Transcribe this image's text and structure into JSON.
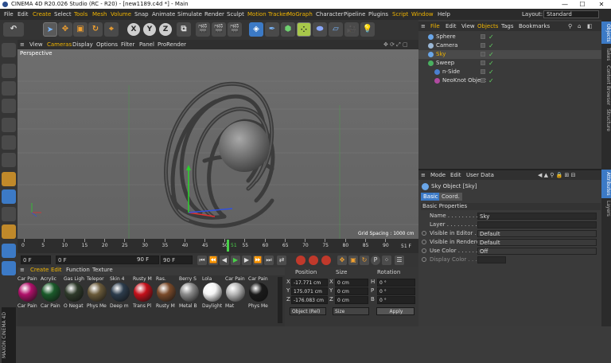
{
  "window": {
    "title": "CINEMA 4D R20.026 Studio (RC - R20) - [new1189.c4d *] - Main",
    "min": "—",
    "max": "☐",
    "close": "✕"
  },
  "menubar": [
    "File",
    "Edit",
    "Create",
    "Select",
    "Tools",
    "Mesh",
    "Volume",
    "Snap",
    "Animate",
    "Simulate",
    "Render",
    "Sculpt",
    "Motion Tracker",
    "MoGraph",
    "Character",
    "Pipeline",
    "Plugins",
    "Script",
    "Window",
    "Help"
  ],
  "layout": {
    "label": "Layout:",
    "value": "Standard"
  },
  "toolbar": {
    "x": "X",
    "y": "Y",
    "z": "Z"
  },
  "viewport": {
    "menu": [
      "View",
      "Cameras",
      "Display",
      "Options",
      "Filter",
      "Panel",
      "ProRender"
    ],
    "label": "Perspective",
    "grid_spacing": "Grid Spacing : 1000 cm"
  },
  "timeline": {
    "ticks": [
      "0",
      "5",
      "10",
      "15",
      "20",
      "25",
      "30",
      "35",
      "40",
      "45",
      "50",
      "55",
      "60",
      "65",
      "70",
      "75",
      "80",
      "85",
      "90"
    ],
    "current": "51",
    "end_label": "51 F"
  },
  "anim": {
    "start": "0 F",
    "min": "0 F",
    "max": "90 F",
    "end": "90 F"
  },
  "materials": {
    "menu": [
      "Create",
      "Edit",
      "Function",
      "Texture"
    ],
    "items": [
      {
        "top": "Car Pain",
        "label": "Car Pain",
        "color": "#b0106a"
      },
      {
        "top": "Acrylic",
        "label": "Car Pain",
        "color": "#1a5a2a"
      },
      {
        "top": "Gas Ligh",
        "label": "O Negat",
        "color": "#2e3a2a"
      },
      {
        "top": "Telepor",
        "label": "Phys Me",
        "color": "#6a5a3a"
      },
      {
        "top": "Skin 4",
        "label": "Deep m",
        "color": "#2c3c4c"
      },
      {
        "top": "Rusty M",
        "label": "Trans Pl",
        "color": "#c4101a"
      },
      {
        "top": "Ras.",
        "label": "Rusty M",
        "color": "#7a4a2a"
      },
      {
        "top": "Berry S",
        "label": "Metal B",
        "color": "#8a8a8a"
      },
      {
        "top": "Lola",
        "label": "Daylight",
        "color": "#f4f4f4"
      },
      {
        "top": "Car Pain",
        "label": "Mat",
        "color": "#b6b6b6"
      },
      {
        "top": "Car Pain",
        "label": "Phys Me",
        "color": "#1a1a1a"
      }
    ]
  },
  "coords": {
    "headers": {
      "position": "Position",
      "size": "Size",
      "rotation": "Rotation"
    },
    "rows": [
      {
        "axis": "X",
        "pos": "-17.771 cm",
        "saxis": "X",
        "size": "0 cm",
        "raxis": "H",
        "rot": "0 °"
      },
      {
        "axis": "Y",
        "pos": "175.071 cm",
        "saxis": "Y",
        "size": "0 cm",
        "raxis": "P",
        "rot": "0 °"
      },
      {
        "axis": "Z",
        "pos": "-176.083 cm",
        "saxis": "Z",
        "size": "0 cm",
        "raxis": "B",
        "rot": "0 °"
      }
    ],
    "mode": "Object (Rel)",
    "size_mode": "Size",
    "apply": "Apply"
  },
  "objects": {
    "menu": [
      "File",
      "Edit",
      "View",
      "Objects",
      "Tags",
      "Bookmarks"
    ],
    "items": [
      {
        "name": "Sphere",
        "color": "#6aa6e8",
        "indent": 0,
        "selected": false
      },
      {
        "name": "Camera",
        "color": "#9bb8d6",
        "indent": 0,
        "selected": false
      },
      {
        "name": "Sky",
        "color": "#6aa6e8",
        "indent": 0,
        "selected": true
      },
      {
        "name": "Sweep",
        "color": "#4ab060",
        "indent": 0,
        "selected": false
      },
      {
        "name": "n-Side",
        "color": "#4a7fd0",
        "indent": 1,
        "selected": false
      },
      {
        "name": "NeoKnot Object",
        "color": "#b04aa0",
        "indent": 1,
        "selected": false
      }
    ]
  },
  "attributes": {
    "menu": [
      "Mode",
      "Edit",
      "User Data"
    ],
    "object_title": "Sky Object [Sky]",
    "tabs": [
      {
        "label": "Basic",
        "on": true
      },
      {
        "label": "Coord.",
        "on": false
      }
    ],
    "section": "Basic Properties",
    "props": [
      {
        "label": "Name . . . . . . . . . . . .",
        "value": "Sky"
      },
      {
        "label": "Layer . . . . . . . . . . . .",
        "value": ""
      },
      {
        "label": "Visible in Editor . .",
        "value": "Default"
      },
      {
        "label": "Visible in Renderer",
        "value": "Default"
      },
      {
        "label": "Use Color . . . . . . .",
        "value": "Off"
      },
      {
        "label": "Display Color . . . . .",
        "value": ""
      }
    ]
  },
  "side_tabs": [
    "Objects",
    "Takes",
    "Content Browser",
    "Structure",
    "Attributes",
    "Layers"
  ],
  "colors": {
    "accent": "#3c7ac6",
    "menu_highlight": "#f0b400",
    "viewport_bg": "#6c6c6c"
  }
}
